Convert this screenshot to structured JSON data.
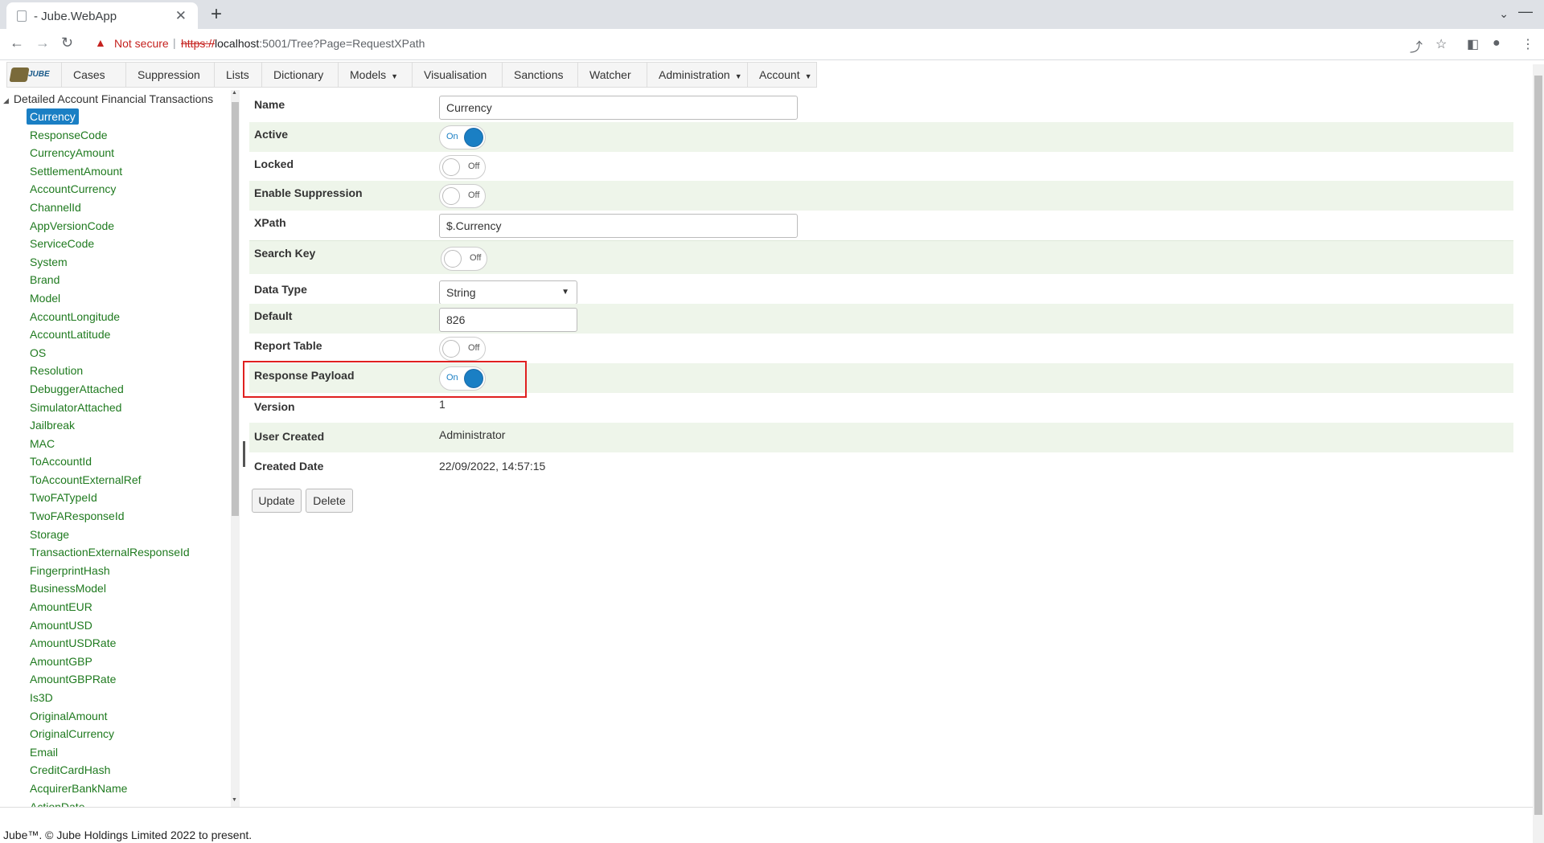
{
  "browser": {
    "tab_title": "- Jube.WebApp",
    "security_label": "Not secure",
    "url_scheme": "https://",
    "url_host": "localhost",
    "url_rest": ":5001/Tree?Page=RequestXPath"
  },
  "nav": {
    "logo_text": "JUBE",
    "items": [
      {
        "label": "Cases",
        "has_menu": false
      },
      {
        "label": "Suppression",
        "has_menu": false
      },
      {
        "label": "Lists",
        "has_menu": false
      },
      {
        "label": "Dictionary",
        "has_menu": false
      },
      {
        "label": "Models",
        "has_menu": true
      },
      {
        "label": "Visualisation",
        "has_menu": false
      },
      {
        "label": "Sanctions",
        "has_menu": false
      },
      {
        "label": "Watcher",
        "has_menu": false
      },
      {
        "label": "Administration",
        "has_menu": true
      },
      {
        "label": "Account",
        "has_menu": true
      }
    ]
  },
  "tree": {
    "root": "Detailed Account Financial Transactions",
    "selected": "Currency",
    "items": [
      "Currency",
      "ResponseCode",
      "CurrencyAmount",
      "SettlementAmount",
      "AccountCurrency",
      "ChannelId",
      "AppVersionCode",
      "ServiceCode",
      "System",
      "Brand",
      "Model",
      "AccountLongitude",
      "AccountLatitude",
      "OS",
      "Resolution",
      "DebuggerAttached",
      "SimulatorAttached",
      "Jailbreak",
      "MAC",
      "ToAccountId",
      "ToAccountExternalRef",
      "TwoFATypeId",
      "TwoFAResponseId",
      "Storage",
      "TransactionExternalResponseId",
      "FingerprintHash",
      "BusinessModel",
      "AmountEUR",
      "AmountUSD",
      "AmountUSDRate",
      "AmountGBP",
      "AmountGBPRate",
      "Is3D",
      "OriginalAmount",
      "OriginalCurrency",
      "Email",
      "CreditCardHash",
      "AcquirerBankName",
      "ActionDate"
    ]
  },
  "form": {
    "name": {
      "label": "Name",
      "value": "Currency"
    },
    "active": {
      "label": "Active",
      "state": "On"
    },
    "locked": {
      "label": "Locked",
      "state": "Off"
    },
    "enable_suppression": {
      "label": "Enable Suppression",
      "state": "Off"
    },
    "xpath": {
      "label": "XPath",
      "value": "$.Currency"
    },
    "search_key": {
      "label": "Search Key",
      "state": "Off"
    },
    "data_type": {
      "label": "Data Type",
      "value": "String"
    },
    "default": {
      "label": "Default",
      "value": "826"
    },
    "report_table": {
      "label": "Report Table",
      "state": "Off"
    },
    "response_payload": {
      "label": "Response Payload",
      "state": "On"
    },
    "version": {
      "label": "Version",
      "value": "1"
    },
    "user_created": {
      "label": "User Created",
      "value": "Administrator"
    },
    "created_date": {
      "label": "Created Date",
      "value": "22/09/2022, 14:57:15"
    }
  },
  "buttons": {
    "update": "Update",
    "delete": "Delete"
  },
  "footer": "Jube™. © Jube Holdings Limited 2022 to present.",
  "colors": {
    "accent": "#1a7fc4",
    "tree_link": "#1f7a1f",
    "row_alt": "#eef5ea",
    "highlight": "#e02020"
  }
}
